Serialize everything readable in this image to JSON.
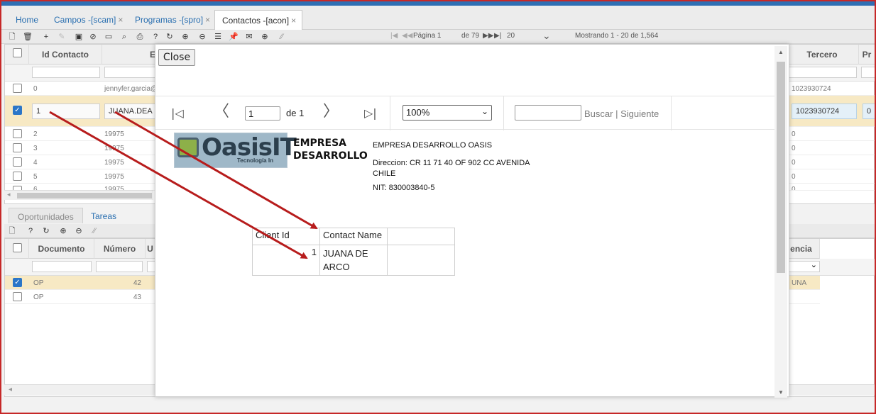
{
  "tabs": [
    {
      "label": "Home"
    },
    {
      "label": "Campos -[scam]",
      "close": "×"
    },
    {
      "label": "Programas -[spro]",
      "close": "×"
    },
    {
      "label": "Contactos -[acon]",
      "close": "×"
    }
  ],
  "pager": {
    "first": "|◀",
    "prev": "◀◀",
    "page_label": "Página 1",
    "of_label": "de 79",
    "next": "▶▶",
    "last": "▶|",
    "page_size": "20",
    "page_size_arrow": "⌄",
    "showing": "Mostrando 1 - 20 de 1,564"
  },
  "grid": {
    "col_id": "Id Contacto",
    "col_email": "E",
    "col_tercero": "Tercero",
    "col_pr": "Pr",
    "rows": [
      {
        "id": "0",
        "email": "jennyfer.garcia@",
        "tercero": "1023930724"
      },
      {
        "id": "1",
        "name": "JUANA.DEA",
        "tercero": "1023930724",
        "pr": "0"
      },
      {
        "id": "2",
        "email": "19975",
        "tercero": "0"
      },
      {
        "id": "3",
        "email": "19975",
        "tercero": "0"
      },
      {
        "id": "4",
        "email": "19975",
        "tercero": "0"
      },
      {
        "id": "5",
        "email": "19975",
        "tercero": "0"
      },
      {
        "id": "6",
        "email": "19975",
        "tercero": "0"
      }
    ],
    "check": "✓"
  },
  "subtabs": [
    {
      "label": "Oportunidades"
    },
    {
      "label": "Tareas"
    }
  ],
  "grid2": {
    "col_documento": "Documento",
    "col_numero": "Número",
    "col_u": "U",
    "col_urgencia": "encia",
    "rows": [
      {
        "doc": "OP",
        "num": "42",
        "urg": "UNA"
      },
      {
        "doc": "OP",
        "num": "43",
        "urg": ""
      }
    ],
    "select_arrow": "⌄"
  },
  "modal": {
    "close_label": "Close",
    "nav_first": "|◁",
    "nav_prev": "〈",
    "page_value": "1",
    "of_label": "de 1",
    "nav_next": "〉",
    "nav_last": "▷|",
    "zoom_value": "100%",
    "zoom_arrow": "⌄",
    "search_label": "Buscar",
    "search_sep": " | ",
    "next_label": "Siguiente"
  },
  "report": {
    "logo_text": "OasisIT",
    "logo_sub": "Tecnología In",
    "company_big": "EMPRESA DESARROLLO",
    "company_name": "EMPRESA DESARROLLO OASIS",
    "address": "Direccion:  CR 11 71 40 OF 902 CC AVENIDA CHILE",
    "nit": "NIT: 830003840-5",
    "table": {
      "headers": [
        "Client Id",
        "Contact Name",
        ""
      ],
      "rows": [
        [
          "1",
          "JUANA DE ARCO",
          ""
        ]
      ]
    }
  },
  "colors": {
    "accent": "#2f6fb3",
    "arrow": "#b71c1c",
    "border": "#c62828",
    "selected_row": "#f7e9c4"
  },
  "toolbar_icons": [
    "new-icon",
    "delete-icon",
    "add-icon",
    "edit-icon",
    "save-icon",
    "cancel-icon",
    "clear-icon",
    "search-icon",
    "print-icon",
    "help-icon",
    "refresh-icon",
    "zoom-in-icon",
    "zoom-out-icon",
    "comment-icon",
    "pin-icon",
    "mail-icon",
    "plus-circle-icon",
    "resize-icon"
  ]
}
